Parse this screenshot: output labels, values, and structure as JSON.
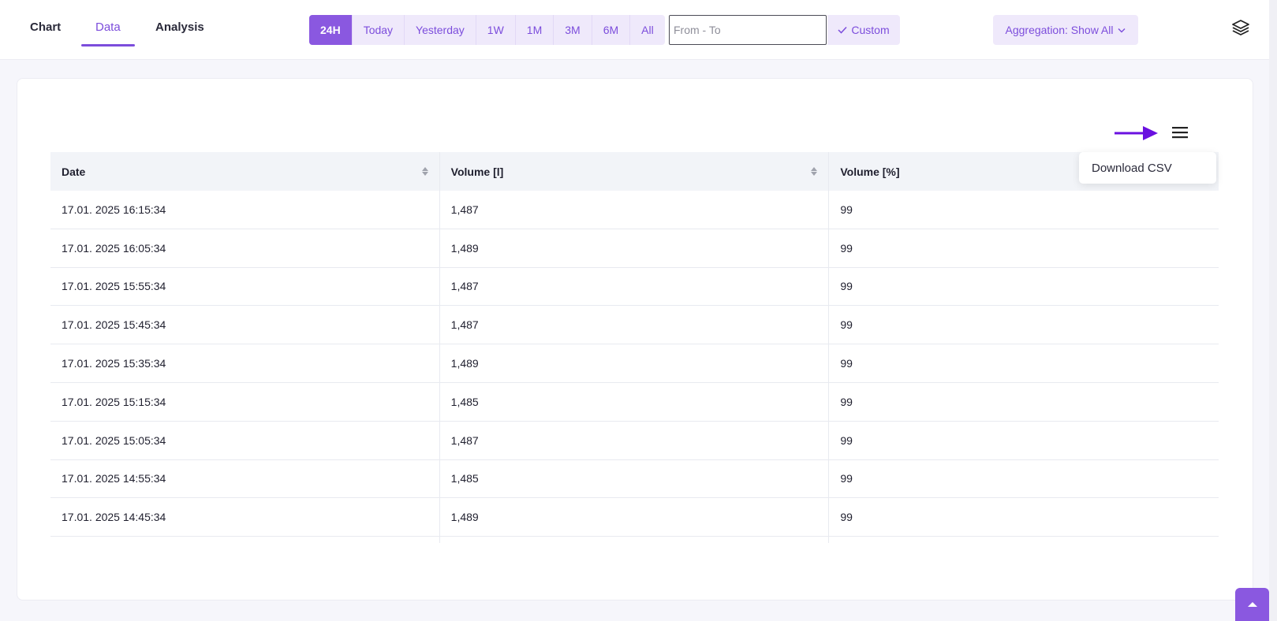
{
  "tabs": [
    {
      "label": "Chart",
      "active": false
    },
    {
      "label": "Data",
      "active": true
    },
    {
      "label": "Analysis",
      "active": false
    }
  ],
  "ranges": [
    {
      "label": "24H",
      "active": true
    },
    {
      "label": "Today",
      "active": false
    },
    {
      "label": "Yesterday",
      "active": false
    },
    {
      "label": "1W",
      "active": false
    },
    {
      "label": "1M",
      "active": false
    },
    {
      "label": "3M",
      "active": false
    },
    {
      "label": "6M",
      "active": false
    },
    {
      "label": "All",
      "active": false
    }
  ],
  "date_input": {
    "placeholder": "From - To",
    "value": ""
  },
  "custom_label": "Custom",
  "aggregation_label": "Aggregation: Show All",
  "menu": {
    "download_csv": "Download CSV"
  },
  "table": {
    "headers": [
      "Date",
      "Volume [l]",
      "Volume [%]"
    ],
    "rows": [
      [
        "17.01. 2025 16:15:34",
        "1,487",
        "99"
      ],
      [
        "17.01. 2025 16:05:34",
        "1,489",
        "99"
      ],
      [
        "17.01. 2025 15:55:34",
        "1,487",
        "99"
      ],
      [
        "17.01. 2025 15:45:34",
        "1,487",
        "99"
      ],
      [
        "17.01. 2025 15:35:34",
        "1,489",
        "99"
      ],
      [
        "17.01. 2025 15:15:34",
        "1,485",
        "99"
      ],
      [
        "17.01. 2025 15:05:34",
        "1,487",
        "99"
      ],
      [
        "17.01. 2025 14:55:34",
        "1,485",
        "99"
      ],
      [
        "17.01. 2025 14:45:34",
        "1,489",
        "99"
      ]
    ]
  },
  "colors": {
    "accent": "#7c4ddc",
    "accent_bg": "#efe9fb",
    "arrow": "#6a10e0"
  }
}
